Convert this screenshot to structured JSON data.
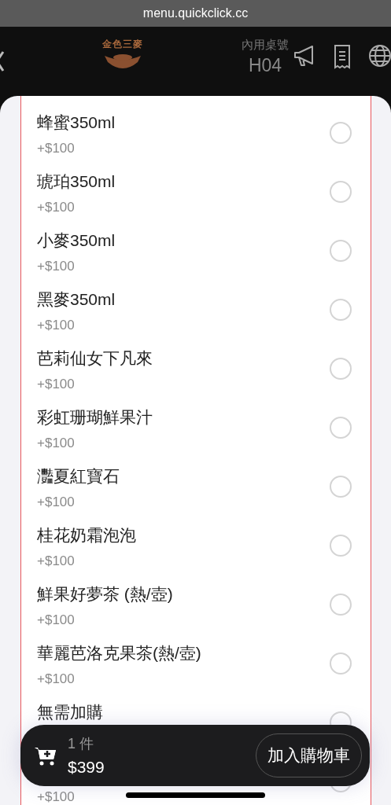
{
  "browser": {
    "url": "menu.quickclick.cc"
  },
  "header": {
    "logo": "金色三麥",
    "table_label": "內用桌號",
    "table_number": "H04"
  },
  "options": [
    {
      "name": "蜂蜜350ml",
      "price": "+$100",
      "selected": false
    },
    {
      "name": "琥珀350ml",
      "price": "+$100",
      "selected": false
    },
    {
      "name": "小麥350ml",
      "price": "+$100",
      "selected": false
    },
    {
      "name": "黑麥350ml",
      "price": "+$100",
      "selected": false
    },
    {
      "name": "芭莉仙女下凡來",
      "price": "+$100",
      "selected": false
    },
    {
      "name": "彩虹珊瑚鮮果汁",
      "price": "+$100",
      "selected": false
    },
    {
      "name": "灩夏紅寶石",
      "price": "+$100",
      "selected": false
    },
    {
      "name": "桂花奶霜泡泡",
      "price": "+$100",
      "selected": false
    },
    {
      "name": "鮮果好夢茶 (熱/壺)",
      "price": "+$100",
      "selected": false
    },
    {
      "name": "華麗芭洛克果茶(熱/壺)",
      "price": "+$100",
      "selected": false
    },
    {
      "name": "無需加購",
      "selected": false
    },
    {
      "price": "+$100",
      "selected": false
    }
  ],
  "cart": {
    "count": "1 件",
    "total": "$399",
    "button": "加入購物車"
  }
}
